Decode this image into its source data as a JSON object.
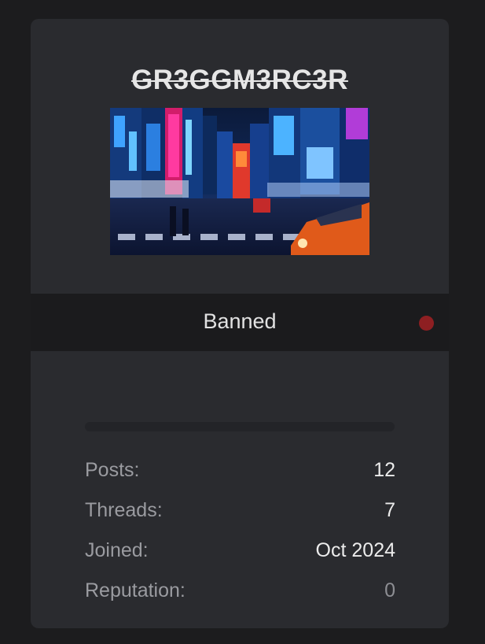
{
  "profile": {
    "username": "GR3GGM3RC3R",
    "avatar_icon": "city-night-street-image",
    "status": {
      "label": "Banned",
      "dot_color": "#8e1f22"
    },
    "progress": 0,
    "stats": [
      {
        "label": "Posts:",
        "value": "12"
      },
      {
        "label": "Threads:",
        "value": "7"
      },
      {
        "label": "Joined:",
        "value": "Oct 2024"
      },
      {
        "label": "Reputation:",
        "value": "0"
      }
    ]
  }
}
